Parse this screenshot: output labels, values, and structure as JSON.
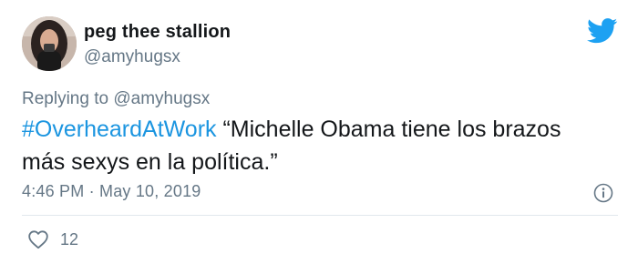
{
  "author": {
    "display_name": "peg thee stallion",
    "handle": "@amyhugsx",
    "avatar_icon": "profile-photo"
  },
  "reply": {
    "prefix": "Replying to ",
    "mention": "@amyhugsx"
  },
  "tweet": {
    "hashtag": "#OverheardAtWork",
    "body": " “Michelle Obama tiene los brazos más sexys en la política.”"
  },
  "meta": {
    "timestamp": "4:46 PM · May 10, 2019",
    "info_icon": "info-icon"
  },
  "actions": {
    "like_icon": "heart-outline-icon",
    "like_count": "12"
  },
  "brand": {
    "icon": "twitter-bird-icon",
    "color": "#1da1f2"
  },
  "colors": {
    "hashtag": "#1b95e0",
    "secondary_text": "#657786",
    "primary_text": "#14171a"
  }
}
